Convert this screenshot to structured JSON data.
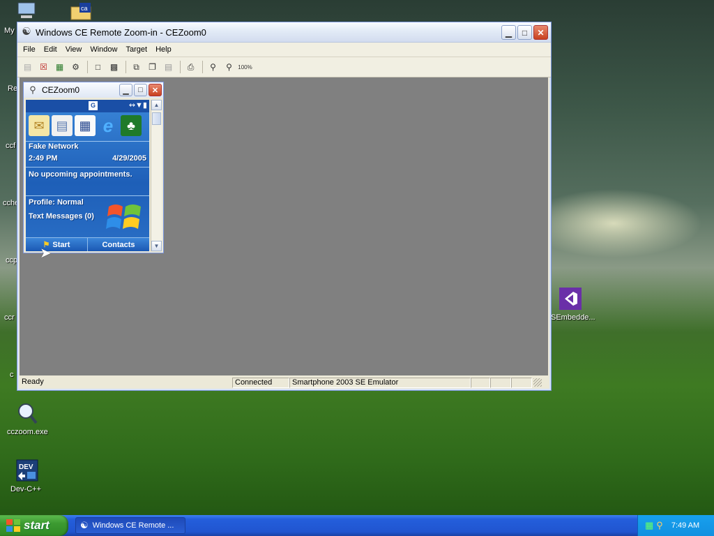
{
  "desktop": {
    "icons": [
      {
        "name": "my-computer-icon",
        "label": "My"
      },
      {
        "name": "ca-folder-icon",
        "label": ""
      },
      {
        "name": "re-icon",
        "label": "Re"
      },
      {
        "name": "ccf-icon",
        "label": "ccf"
      },
      {
        "name": "cche-icon",
        "label": "cche"
      },
      {
        "name": "ccp-icon",
        "label": "ccp"
      },
      {
        "name": "ccr-icon",
        "label": "ccr"
      },
      {
        "name": "cc-icon",
        "label": "c"
      },
      {
        "name": "cczoom-exe-icon",
        "label": "cczoom.exe"
      },
      {
        "name": "dev-cpp-icon",
        "label": "Dev-C++"
      },
      {
        "name": "sembedded-icon",
        "label": "SEmbedde..."
      }
    ]
  },
  "window": {
    "title": "Windows CE Remote Zoom-in - CEZoom0",
    "menu": [
      "File",
      "Edit",
      "View",
      "Window",
      "Target",
      "Help"
    ],
    "status": {
      "ready": "Ready",
      "connected": "Connected",
      "device": "Smartphone 2003 SE Emulator"
    },
    "toolbar_zoom_label": "100%"
  },
  "child": {
    "title": "CEZoom0",
    "device": {
      "badge": "G",
      "network": "Fake Network",
      "time": "2:49 PM",
      "date": "4/29/2005",
      "appointments": "No upcoming appointments.",
      "profile": "Profile: Normal",
      "messages": "Text Messages (0)",
      "softkey_left": "Start",
      "softkey_right": "Contacts"
    }
  },
  "taskbar": {
    "start_label": "start",
    "task_label": "Windows CE Remote ...",
    "clock": "7:49 AM"
  }
}
